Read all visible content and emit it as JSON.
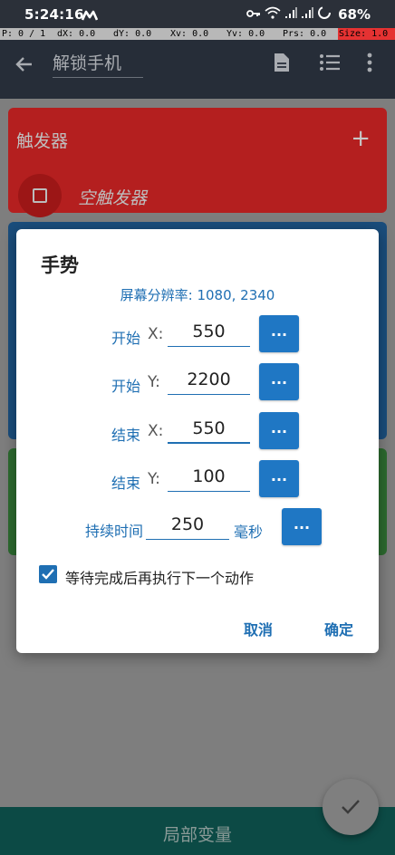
{
  "status_bar": {
    "time": "5:24:16",
    "battery": "68%",
    "icons": [
      "m-logo-icon",
      "key-icon",
      "wifi-icon",
      "signal-icon",
      "signal-icon",
      "battery-circle-icon"
    ]
  },
  "pointer_bar": {
    "p": "P: 0 / 1",
    "dx": "dX: 0.0",
    "dy": "dY: 0.0",
    "xv": "Xv: 0.0",
    "yv": "Yv: 0.0",
    "prs": "Prs: 0.0",
    "size": "Size: 1.0"
  },
  "app_bar": {
    "title": "解锁手机",
    "icons": [
      "back-arrow-icon",
      "document-icon",
      "list-icon",
      "more-vert-icon"
    ]
  },
  "trigger_card": {
    "title": "触发器",
    "empty_label": "空触发器"
  },
  "bottom_bar": {
    "label": "局部变量"
  },
  "dialog": {
    "title": "手势",
    "resolution": "屏幕分辨率: 1080, 2340",
    "rows": [
      {
        "label": "开始",
        "axis": "X:",
        "value": "550",
        "button": "..."
      },
      {
        "label": "开始",
        "axis": "Y:",
        "value": "2200",
        "button": "..."
      },
      {
        "label": "结束",
        "axis": "X:",
        "value": "550",
        "button": "..."
      },
      {
        "label": "结束",
        "axis": "Y:",
        "value": "100",
        "button": "..."
      }
    ],
    "duration": {
      "label": "持续时间",
      "value": "250",
      "unit": "毫秒",
      "button": "..."
    },
    "wait_checkbox": {
      "label": "等待完成后再执行下一个动作",
      "checked": true
    },
    "cancel": "取消",
    "ok": "确定"
  },
  "colors": {
    "accent": "#1f77c4",
    "text_blue": "#1f6fb3",
    "trigger_red": "#b41f1f",
    "bottom_teal": "#0c4a45"
  }
}
